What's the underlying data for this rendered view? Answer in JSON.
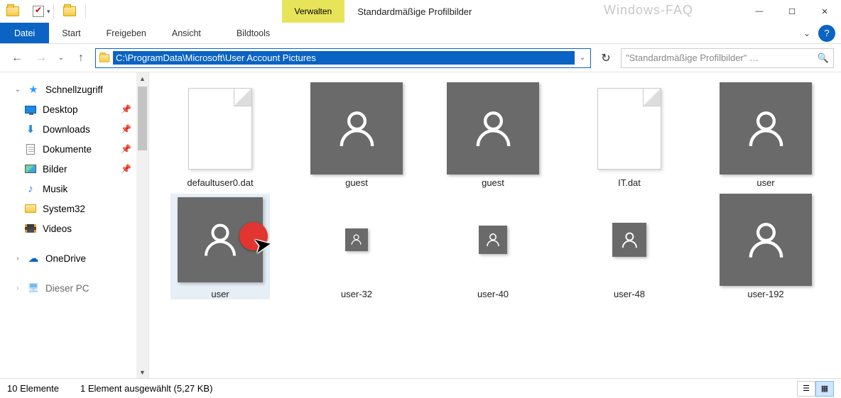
{
  "watermark": "Windows-FAQ",
  "titlebar": {
    "context_tab_hdr": "Verwalten",
    "window_title": "Standardmäßige Profilbilder"
  },
  "window_controls": {
    "min": "—",
    "max": "☐",
    "close": "✕"
  },
  "ribbon": {
    "file": "Datei",
    "tabs": [
      "Start",
      "Freigeben",
      "Ansicht"
    ],
    "context_tab": "Bildtools",
    "collapse": "⌄",
    "help": "?"
  },
  "nav": {
    "back": "←",
    "fwd": "→",
    "history": "⌄",
    "up": "↑",
    "refresh": "↻",
    "path": "C:\\ProgramData\\Microsoft\\User Account Pictures",
    "addr_dd": "⌄"
  },
  "search": {
    "placeholder": "\"Standardmäßige Profilbilder\" …",
    "icon": "🔍"
  },
  "sidebar": {
    "quick_access": "Schnellzugriff",
    "items": [
      {
        "icon": "desk",
        "label": "Desktop",
        "pinned": true
      },
      {
        "icon": "dl",
        "label": "Downloads",
        "pinned": true
      },
      {
        "icon": "doc",
        "label": "Dokumente",
        "pinned": true
      },
      {
        "icon": "pic",
        "label": "Bilder",
        "pinned": true
      },
      {
        "icon": "music",
        "label": "Musik",
        "pinned": false
      },
      {
        "icon": "folder",
        "label": "System32",
        "pinned": false
      },
      {
        "icon": "vid",
        "label": "Videos",
        "pinned": false
      }
    ],
    "onedrive": "OneDrive",
    "this_pc": "Dieser PC",
    "scroll": {
      "up": "▲",
      "down": "▼"
    }
  },
  "files": {
    "row1": [
      {
        "kind": "dat",
        "label": "defaultuser0.dat"
      },
      {
        "kind": "avatar",
        "size": 130,
        "label": "guest"
      },
      {
        "kind": "avatar",
        "size": 130,
        "label": "guest"
      },
      {
        "kind": "dat",
        "label": "IT.dat"
      },
      {
        "kind": "avatar",
        "size": 130,
        "label": "user"
      }
    ],
    "row2": [
      {
        "kind": "avatar",
        "size": 120,
        "label": "user",
        "selected": true
      },
      {
        "kind": "avatar",
        "size": 32,
        "label": "user-32"
      },
      {
        "kind": "avatar",
        "size": 40,
        "label": "user-40"
      },
      {
        "kind": "avatar",
        "size": 48,
        "label": "user-48"
      },
      {
        "kind": "avatar",
        "size": 130,
        "label": "user-192"
      }
    ]
  },
  "status": {
    "items": "10 Elemente",
    "selection": "1 Element ausgewählt (5,27 KB)"
  },
  "pin_glyph": "📌"
}
